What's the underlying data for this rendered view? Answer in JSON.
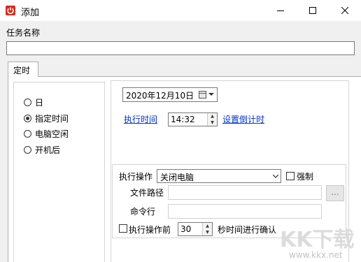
{
  "window": {
    "title": "添加"
  },
  "task_name": {
    "label": "任务名称",
    "value": ""
  },
  "tabs": [
    {
      "label": "定时"
    }
  ],
  "schedule_options": [
    {
      "label": "日",
      "selected": false
    },
    {
      "label": "指定时间",
      "selected": true
    },
    {
      "label": "电脑空闲",
      "selected": false
    },
    {
      "label": "开机后",
      "selected": false
    }
  ],
  "date_picker": {
    "value": "2020年12月10日"
  },
  "exec_time": {
    "link_label": "执行时间",
    "value": "14:32",
    "countdown_link": "设置倒计时"
  },
  "operation": {
    "label": "执行操作",
    "selected": "关闭电脑",
    "force_label": "强制",
    "file_path_label": "文件路径",
    "file_path_value": "",
    "browse_label": "...",
    "command_label": "命令行",
    "command_value": "",
    "confirm_label": "执行操作前",
    "confirm_seconds": "30",
    "confirm_suffix": "秒时间进行确认"
  },
  "watermark": {
    "logo": "KK下载",
    "url": "www.kkx.net"
  }
}
